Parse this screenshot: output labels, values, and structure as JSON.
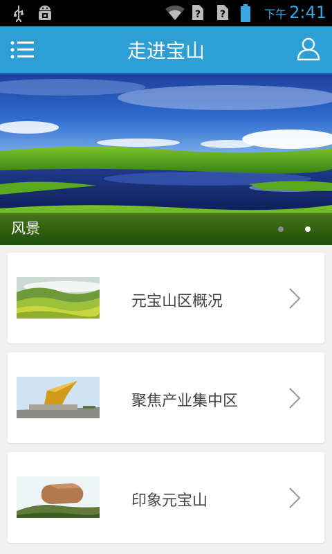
{
  "status_bar": {
    "ampm": "下午",
    "time": "2:41",
    "icons": [
      "usb-icon",
      "android-debug-icon",
      "wifi-icon",
      "sim-unknown-icon",
      "sim-unknown-icon",
      "battery-icon"
    ]
  },
  "header": {
    "title": "走进宝山",
    "menu_icon": "menu-list-icon",
    "user_icon": "user-icon",
    "accent_color": "#2e9fd4"
  },
  "banner": {
    "caption": "风景",
    "slide_count": 2,
    "active_slide": 2
  },
  "list": {
    "items": [
      {
        "label": "元宝山区概况",
        "thumb": "terraced-hills-image"
      },
      {
        "label": "聚焦产业集中区",
        "thumb": "monument-sculpture-image"
      },
      {
        "label": "印象元宝山",
        "thumb": "rock-formation-image"
      }
    ]
  }
}
